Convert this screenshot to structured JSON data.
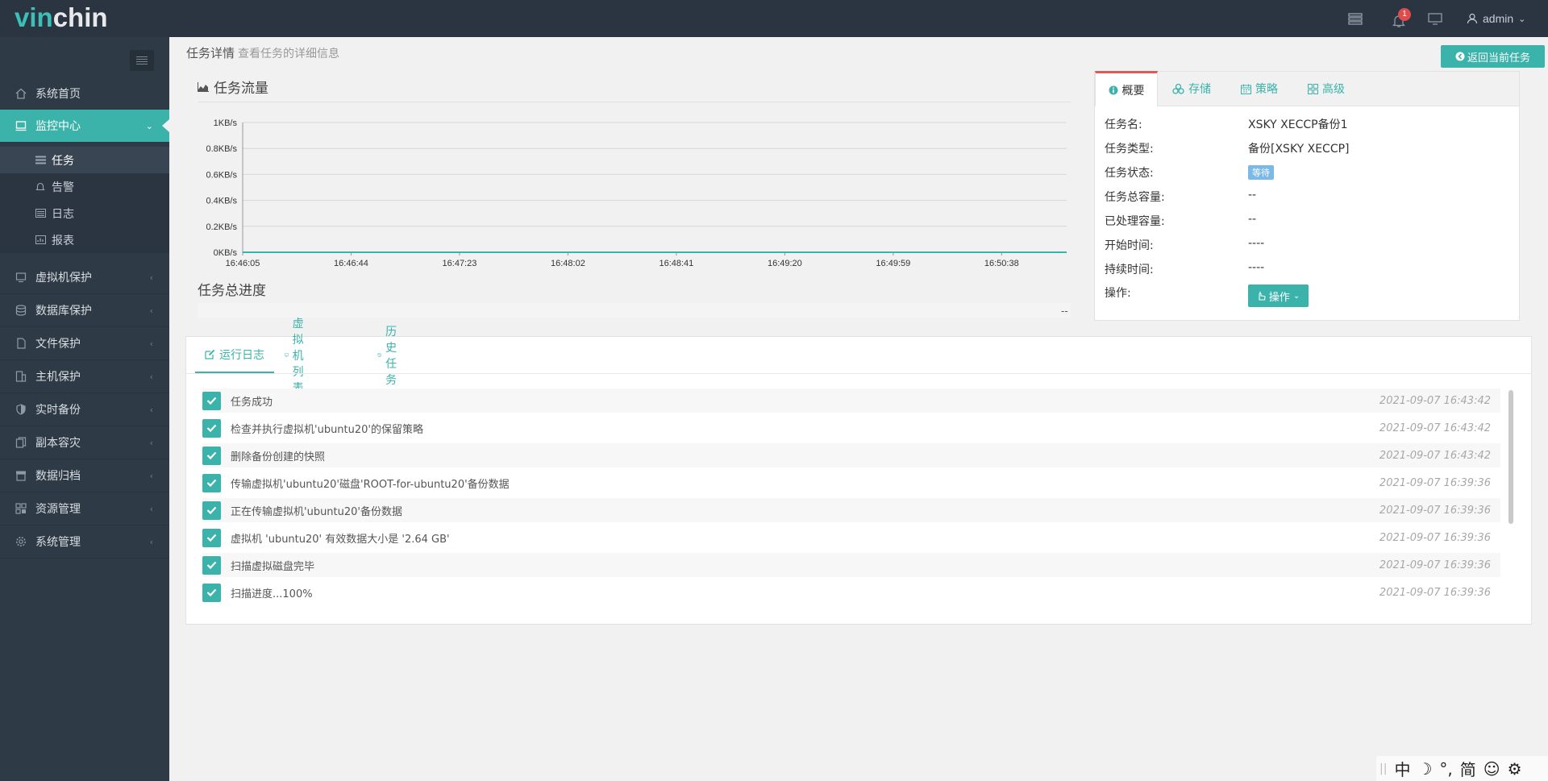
{
  "app": {
    "logo_vin": "vin",
    "logo_chin": "chin"
  },
  "topbar": {
    "notification_count": "1",
    "user": "admin"
  },
  "sidebar": {
    "items": [
      {
        "label": "系统首页",
        "icon": "home-icon"
      },
      {
        "label": "监控中心",
        "icon": "monitor-icon",
        "active": true
      },
      {
        "label": "虚拟机保护",
        "icon": "vm-icon"
      },
      {
        "label": "数据库保护",
        "icon": "database-icon"
      },
      {
        "label": "文件保护",
        "icon": "file-icon"
      },
      {
        "label": "主机保护",
        "icon": "host-icon"
      },
      {
        "label": "实时备份",
        "icon": "shield-icon"
      },
      {
        "label": "副本容灾",
        "icon": "copy-icon"
      },
      {
        "label": "数据归档",
        "icon": "archive-icon"
      },
      {
        "label": "资源管理",
        "icon": "resource-icon"
      },
      {
        "label": "系统管理",
        "icon": "gear-icon"
      }
    ],
    "sub_items": [
      {
        "label": "任务",
        "active": true
      },
      {
        "label": "告警"
      },
      {
        "label": "日志"
      },
      {
        "label": "报表"
      }
    ]
  },
  "header": {
    "title": "任务详情",
    "subtitle": "查看任务的详细信息",
    "back_label": "返回当前任务"
  },
  "traffic": {
    "title": "任务流量"
  },
  "chart_data": {
    "type": "line",
    "title": "任务流量",
    "x": [
      "16:46:05",
      "16:46:44",
      "16:47:23",
      "16:48:02",
      "16:48:41",
      "16:49:20",
      "16:49:59",
      "16:50:38"
    ],
    "y_ticks": [
      "0KB/s",
      "0.2KB/s",
      "0.4KB/s",
      "0.6KB/s",
      "0.8KB/s",
      "1KB/s"
    ],
    "ylim": [
      0,
      1
    ],
    "series": [
      {
        "values": [
          0,
          0,
          0,
          0,
          0,
          0,
          0,
          0,
          0
        ],
        "color": "#3bb3aa"
      }
    ],
    "grid": true
  },
  "progress": {
    "title": "任务总进度",
    "value": "--"
  },
  "info": {
    "tabs": [
      {
        "label": "概要",
        "active": true
      },
      {
        "label": "存储"
      },
      {
        "label": "策略"
      },
      {
        "label": "高级"
      }
    ],
    "rows": [
      {
        "label": "任务名:",
        "value": "XSKY XECCP备份1"
      },
      {
        "label": "任务类型:",
        "value": "备份[XSKY XECCP]"
      },
      {
        "label": "任务状态:",
        "value": "等待"
      },
      {
        "label": "任务总容量:",
        "value": "--"
      },
      {
        "label": "已处理容量:",
        "value": "--"
      },
      {
        "label": "开始时间:",
        "value": "----"
      },
      {
        "label": "持续时间:",
        "value": "----"
      },
      {
        "label": "操作:",
        "value": "操作"
      }
    ],
    "status_color": "#7ab9e8"
  },
  "log": {
    "tabs": [
      {
        "label": "运行日志",
        "active": true
      },
      {
        "label": "虚拟机列表"
      },
      {
        "label": "历史任务"
      }
    ],
    "entries": [
      {
        "msg": "任务成功",
        "time": "2021-09-07 16:43:42"
      },
      {
        "msg": "检查并执行虚拟机'ubuntu20'的保留策略",
        "time": "2021-09-07 16:43:42"
      },
      {
        "msg": "删除备份创建的快照",
        "time": "2021-09-07 16:43:42"
      },
      {
        "msg": "传输虚拟机'ubuntu20'磁盘'ROOT-for-ubuntu20'备份数据",
        "time": "2021-09-07 16:39:36"
      },
      {
        "msg": "正在传输虚拟机'ubuntu20'备份数据",
        "time": "2021-09-07 16:39:36"
      },
      {
        "msg": "虚拟机 'ubuntu20' 有效数据大小是 '2.64 GB'",
        "time": "2021-09-07 16:39:36"
      },
      {
        "msg": "扫描虚拟磁盘完毕",
        "time": "2021-09-07 16:39:36"
      },
      {
        "msg": "扫描进度...100%",
        "time": "2021-09-07 16:39:36"
      }
    ]
  },
  "ime": {
    "lang": "中",
    "moon": "☽",
    "punct": "°,",
    "simp": "简",
    "smile": "☺",
    "gear": "⚙"
  }
}
